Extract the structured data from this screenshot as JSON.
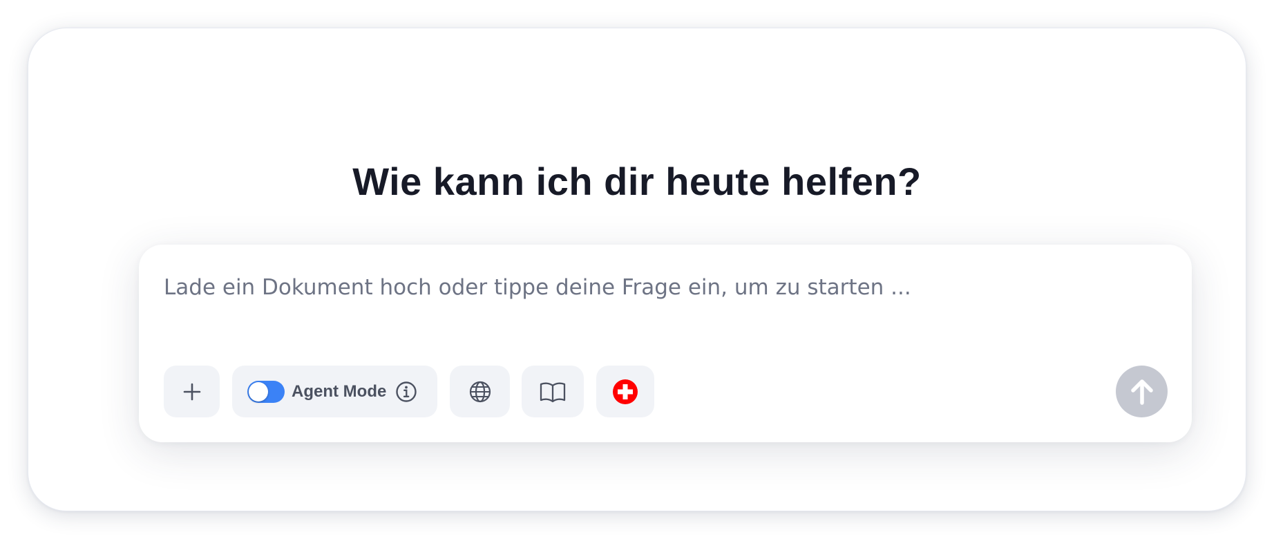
{
  "heading": "Wie kann ich dir heute helfen?",
  "composer": {
    "placeholder": "Lade ein Dokument hoch oder tippe deine Frage ein, um zu starten ...",
    "value": ""
  },
  "toolbar": {
    "add": {
      "icon": "plus-icon"
    },
    "agent_mode": {
      "label": "Agent Mode",
      "enabled": false,
      "toggle_color": "#3b82f6",
      "icon": "info-icon"
    },
    "web": {
      "icon": "globe-icon"
    },
    "library": {
      "icon": "book-icon"
    },
    "swiss": {
      "icon": "swiss-cross-icon",
      "color": "#ff0000"
    }
  },
  "send": {
    "icon": "arrow-up-icon",
    "enabled": false,
    "color": "#c5c8d1"
  },
  "colors": {
    "heading": "#171a27",
    "placeholder": "#6d7384",
    "button_bg": "#f1f3f7"
  }
}
